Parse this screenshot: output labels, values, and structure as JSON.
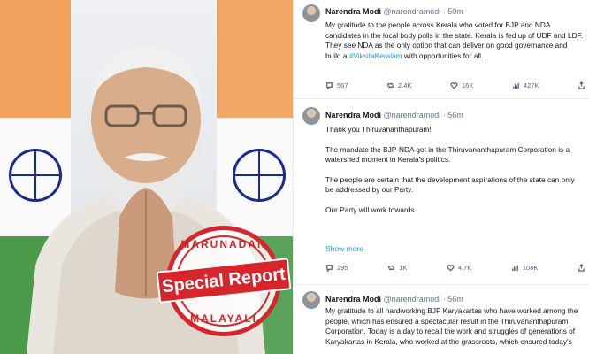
{
  "stamp": {
    "top_text": "MARUNADAN",
    "banner_text": "Special Report",
    "bottom_text": "MALAYALI"
  },
  "tweets": [
    {
      "name": "Narendra Modi",
      "handle": "@narendramodi",
      "time": "· 50m",
      "text_1": "My gratitude to the people across Kerala who voted for BJP and NDA candidates in the local body polls in the state. Kerala is fed up of UDF and LDF. They see NDA as the only option that can deliver on good governance and build a ",
      "hashtag": "#ViksitaKeralam",
      "text_2": " with opportunities for all.",
      "replies": "567",
      "retweets": "2.4K",
      "likes": "16K",
      "views": "427K"
    },
    {
      "name": "Narendra Modi",
      "handle": "@narendramodi",
      "time": "· 56m",
      "p1": "Thank you Thiruvananthapuram!",
      "p2": "The mandate the BJP-NDA got in the Thiruvananthapuram Corporation is a watershed moment in Kerala's politics.",
      "p3": " The people are certain that the development aspirations of the state can only be addressed by our Party.",
      "p4": "Our Party will work towards",
      "show_more": "Show more",
      "replies": "295",
      "retweets": "1K",
      "likes": "4.7K",
      "views": "108K"
    },
    {
      "name": "Narendra Modi",
      "handle": "@narendramodi",
      "time": "· 56m",
      "text": "My gratitude to all hardworking BJP Karyakartas who have worked among the people, which has ensured a spectacular result in the Thiruvananthapuram Corporation. Today is a day to recall the work and struggles of generations of Karyakartas in Kerala, who worked at the grassroots, which ensured today's"
    }
  ]
}
